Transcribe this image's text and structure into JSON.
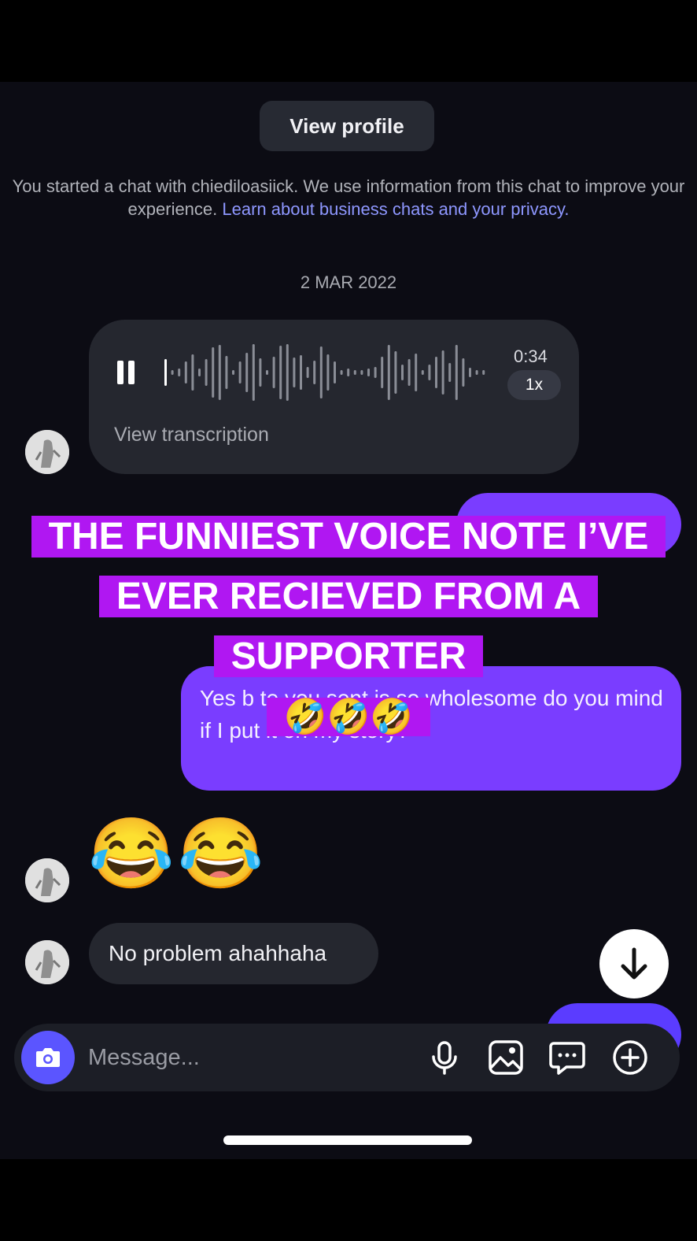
{
  "header": {
    "view_profile_label": "View profile"
  },
  "notice": {
    "text": "You started a chat with chiediloasiick. We use information from this chat to improve your experience. ",
    "link": "Learn about business chats and your privacy."
  },
  "date_divider": "2 MAR 2022",
  "voice_message": {
    "duration": "0:34",
    "speed": "1x",
    "transcription_label": "View transcription",
    "playback_state": "playing"
  },
  "sent_message": {
    "text": "Yes b te you sent is so wholesome do you mind if I put it on my story?"
  },
  "received_emoji": "😂😂",
  "received_reply": "No problem ahahhaha",
  "composer": {
    "placeholder": "Message..."
  },
  "caption": {
    "text": "THE FUNNIEST VOICE NOTE I’VE EVER RECIEVED FROM A SUPPORTER",
    "emoji": "🤣🤣🤣"
  },
  "colors": {
    "sent_bubble": "#7a3dff",
    "caption_bg": "#b017f2",
    "link": "#8e97ff",
    "camera": "#5b55ff"
  },
  "icons": [
    "pause-icon",
    "camera-icon",
    "microphone-icon",
    "image-icon",
    "sticker-icon",
    "add-icon",
    "arrow-down-icon",
    "avatar"
  ]
}
